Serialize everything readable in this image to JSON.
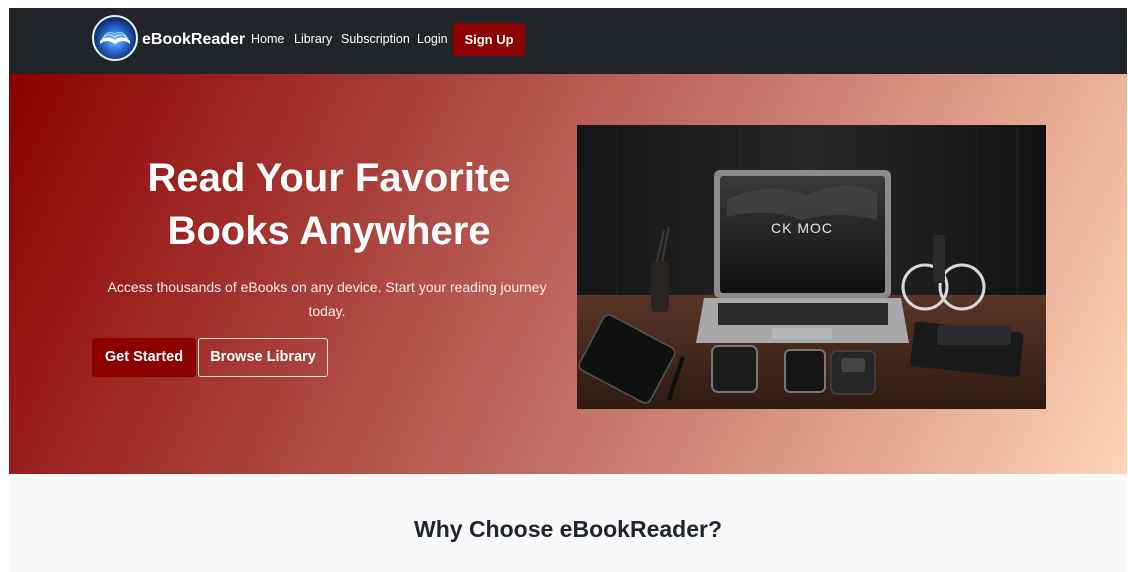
{
  "navbar": {
    "brand": "eBookReader",
    "links": [
      "Home",
      "Library",
      "Subscription",
      "Login"
    ],
    "signup_label": "Sign Up"
  },
  "hero": {
    "title_line1": "Read Your Favorite",
    "title_line2": "Books Anywhere",
    "subtitle_line1": "Access thousands of eBooks on any device. Start your reading journey",
    "subtitle_line2": "today.",
    "primary_button": "Get Started",
    "secondary_button": "Browse Library",
    "image_screen_text": "CK MOC"
  },
  "features": {
    "title": "Why Choose eBookReader?"
  },
  "colors": {
    "navbar_bg": "#212529",
    "accent": "#8b0000",
    "hero_gradient_start": "#8b0000",
    "hero_gradient_end": "#fcd6b8",
    "features_bg": "#f8f9fa"
  },
  "icons": {
    "logo": "open-book-logo-icon"
  }
}
